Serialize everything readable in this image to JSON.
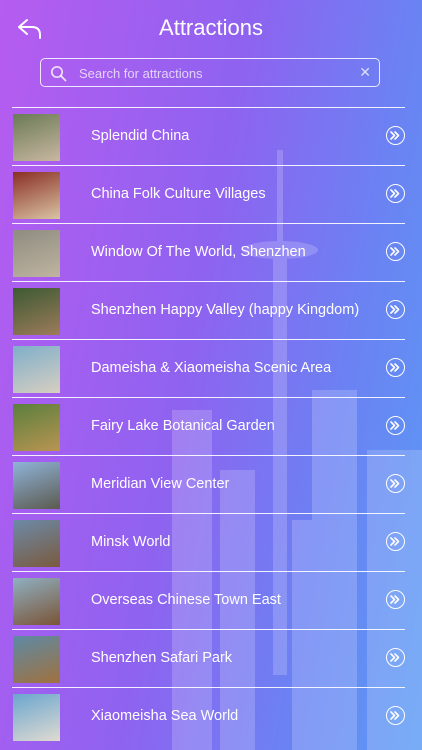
{
  "header": {
    "title": "Attractions",
    "back_icon": "back-arrow-icon"
  },
  "search": {
    "placeholder": "Search for attractions",
    "value": "",
    "icon": "search-icon",
    "clear_glyph": "✕"
  },
  "attractions": [
    {
      "name": "Splendid China",
      "thumb_colors": [
        "#6a7a56",
        "#c9b7a1"
      ]
    },
    {
      "name": "China Folk Culture Villages",
      "thumb_colors": [
        "#8a2e24",
        "#d9c4a4"
      ]
    },
    {
      "name": "Window Of The World, Shenzhen",
      "thumb_colors": [
        "#8e8c80",
        "#bfb4a0"
      ]
    },
    {
      "name": "Shenzhen Happy Valley (happy Kingdom)",
      "thumb_colors": [
        "#3c5a32",
        "#9d7b5a"
      ]
    },
    {
      "name": "Dameisha & Xiaomeisha Scenic Area",
      "thumb_colors": [
        "#7faeca",
        "#d7cfc1"
      ]
    },
    {
      "name": "Fairy Lake Botanical Garden",
      "thumb_colors": [
        "#5b7f3d",
        "#b99452"
      ]
    },
    {
      "name": "Meridian View Center",
      "thumb_colors": [
        "#8fb4d9",
        "#5c5a4f"
      ]
    },
    {
      "name": "Minsk World",
      "thumb_colors": [
        "#6c8aa8",
        "#7a5a3e"
      ]
    },
    {
      "name": "Overseas Chinese Town East",
      "thumb_colors": [
        "#8fb0c2",
        "#7b5436"
      ]
    },
    {
      "name": "Shenzhen Safari Park",
      "thumb_colors": [
        "#5d8aa6",
        "#a0713e"
      ]
    },
    {
      "name": "Xiaomeisha Sea World",
      "thumb_colors": [
        "#6aa6cf",
        "#e0dad0"
      ]
    }
  ],
  "colors": {
    "gradient_left": "#b65cf0",
    "gradient_right": "#5a9bf4",
    "divider": "#ffffff"
  }
}
